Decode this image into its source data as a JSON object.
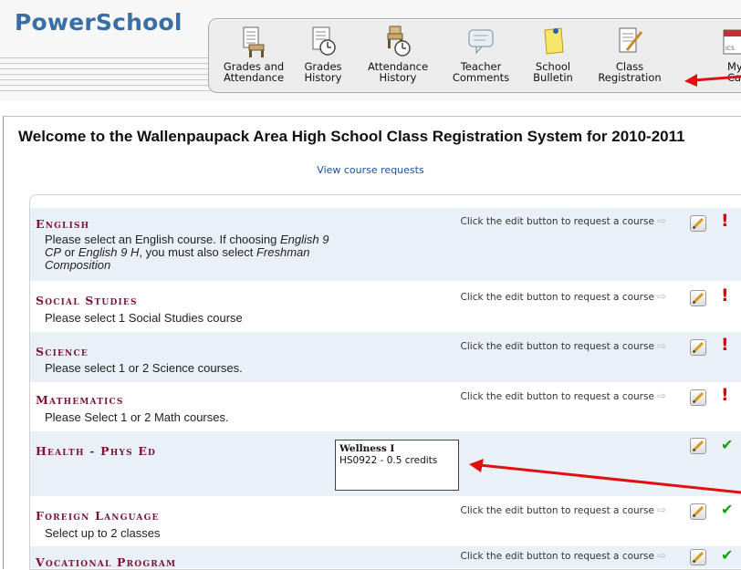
{
  "app": {
    "logo": "PowerSchool"
  },
  "toolbar": {
    "items": [
      {
        "label": "Grades and\nAttendance",
        "icon": "grades-attendance-icon"
      },
      {
        "label": "Grades\nHistory",
        "icon": "grades-history-icon"
      },
      {
        "label": "Attendance\nHistory",
        "icon": "attendance-history-icon"
      },
      {
        "label": "Teacher\nComments",
        "icon": "teacher-comments-icon"
      },
      {
        "label": "School\nBulletin",
        "icon": "school-bulletin-icon"
      },
      {
        "label": "Class\nRegistration",
        "icon": "class-registration-icon"
      },
      {
        "label": "My\nCalendar",
        "icon": "calendar-icon"
      }
    ]
  },
  "page": {
    "title": "Welcome to the Wallenpaupack Area High School Class Registration System for 2010-2011",
    "view_requests_link": "View course requests"
  },
  "hint_text": "Click the edit button to request a course",
  "subjects": [
    {
      "name": "English",
      "description_parts": [
        {
          "text": "Please select an English course. If choosing ",
          "italic": false
        },
        {
          "text": "English 9 CP",
          "italic": true
        },
        {
          "text": " or ",
          "italic": false
        },
        {
          "text": "English 9 H",
          "italic": true
        },
        {
          "text": ", you must also select ",
          "italic": false
        },
        {
          "text": "Freshman Composition",
          "italic": true
        }
      ],
      "status": "incomplete",
      "show_hint": true
    },
    {
      "name": "Social Studies",
      "description_parts": [
        {
          "text": "Please select 1 Social Studies course",
          "italic": false
        }
      ],
      "status": "incomplete",
      "show_hint": true
    },
    {
      "name": "Science",
      "description_parts": [
        {
          "text": "Please select 1 or 2 Science courses.",
          "italic": false
        }
      ],
      "status": "incomplete",
      "show_hint": true
    },
    {
      "name": "Mathematics",
      "description_parts": [
        {
          "text": "Please Select 1 or 2 Math courses.",
          "italic": false
        }
      ],
      "status": "incomplete",
      "show_hint": true
    },
    {
      "name": "Health - Phys Ed",
      "description_parts": [],
      "status": "complete",
      "show_hint": false,
      "selected_course": {
        "name": "Wellness I",
        "code_credits": "HS0922 - 0.5 credits"
      }
    },
    {
      "name": "Foreign Language",
      "description_parts": [
        {
          "text": "Select up to 2 classes",
          "italic": false
        }
      ],
      "status": "complete",
      "show_hint": true
    },
    {
      "name": "Vocational Program",
      "description_parts": [],
      "status": "complete",
      "show_hint": true
    }
  ],
  "status_icons": {
    "incomplete": "!",
    "complete": "✔"
  },
  "colors": {
    "accent": "#3a6fa3",
    "subject": "#7a1435",
    "alert": "#e00000",
    "ok": "#12a012",
    "annotation_arrow": "#e01010"
  }
}
